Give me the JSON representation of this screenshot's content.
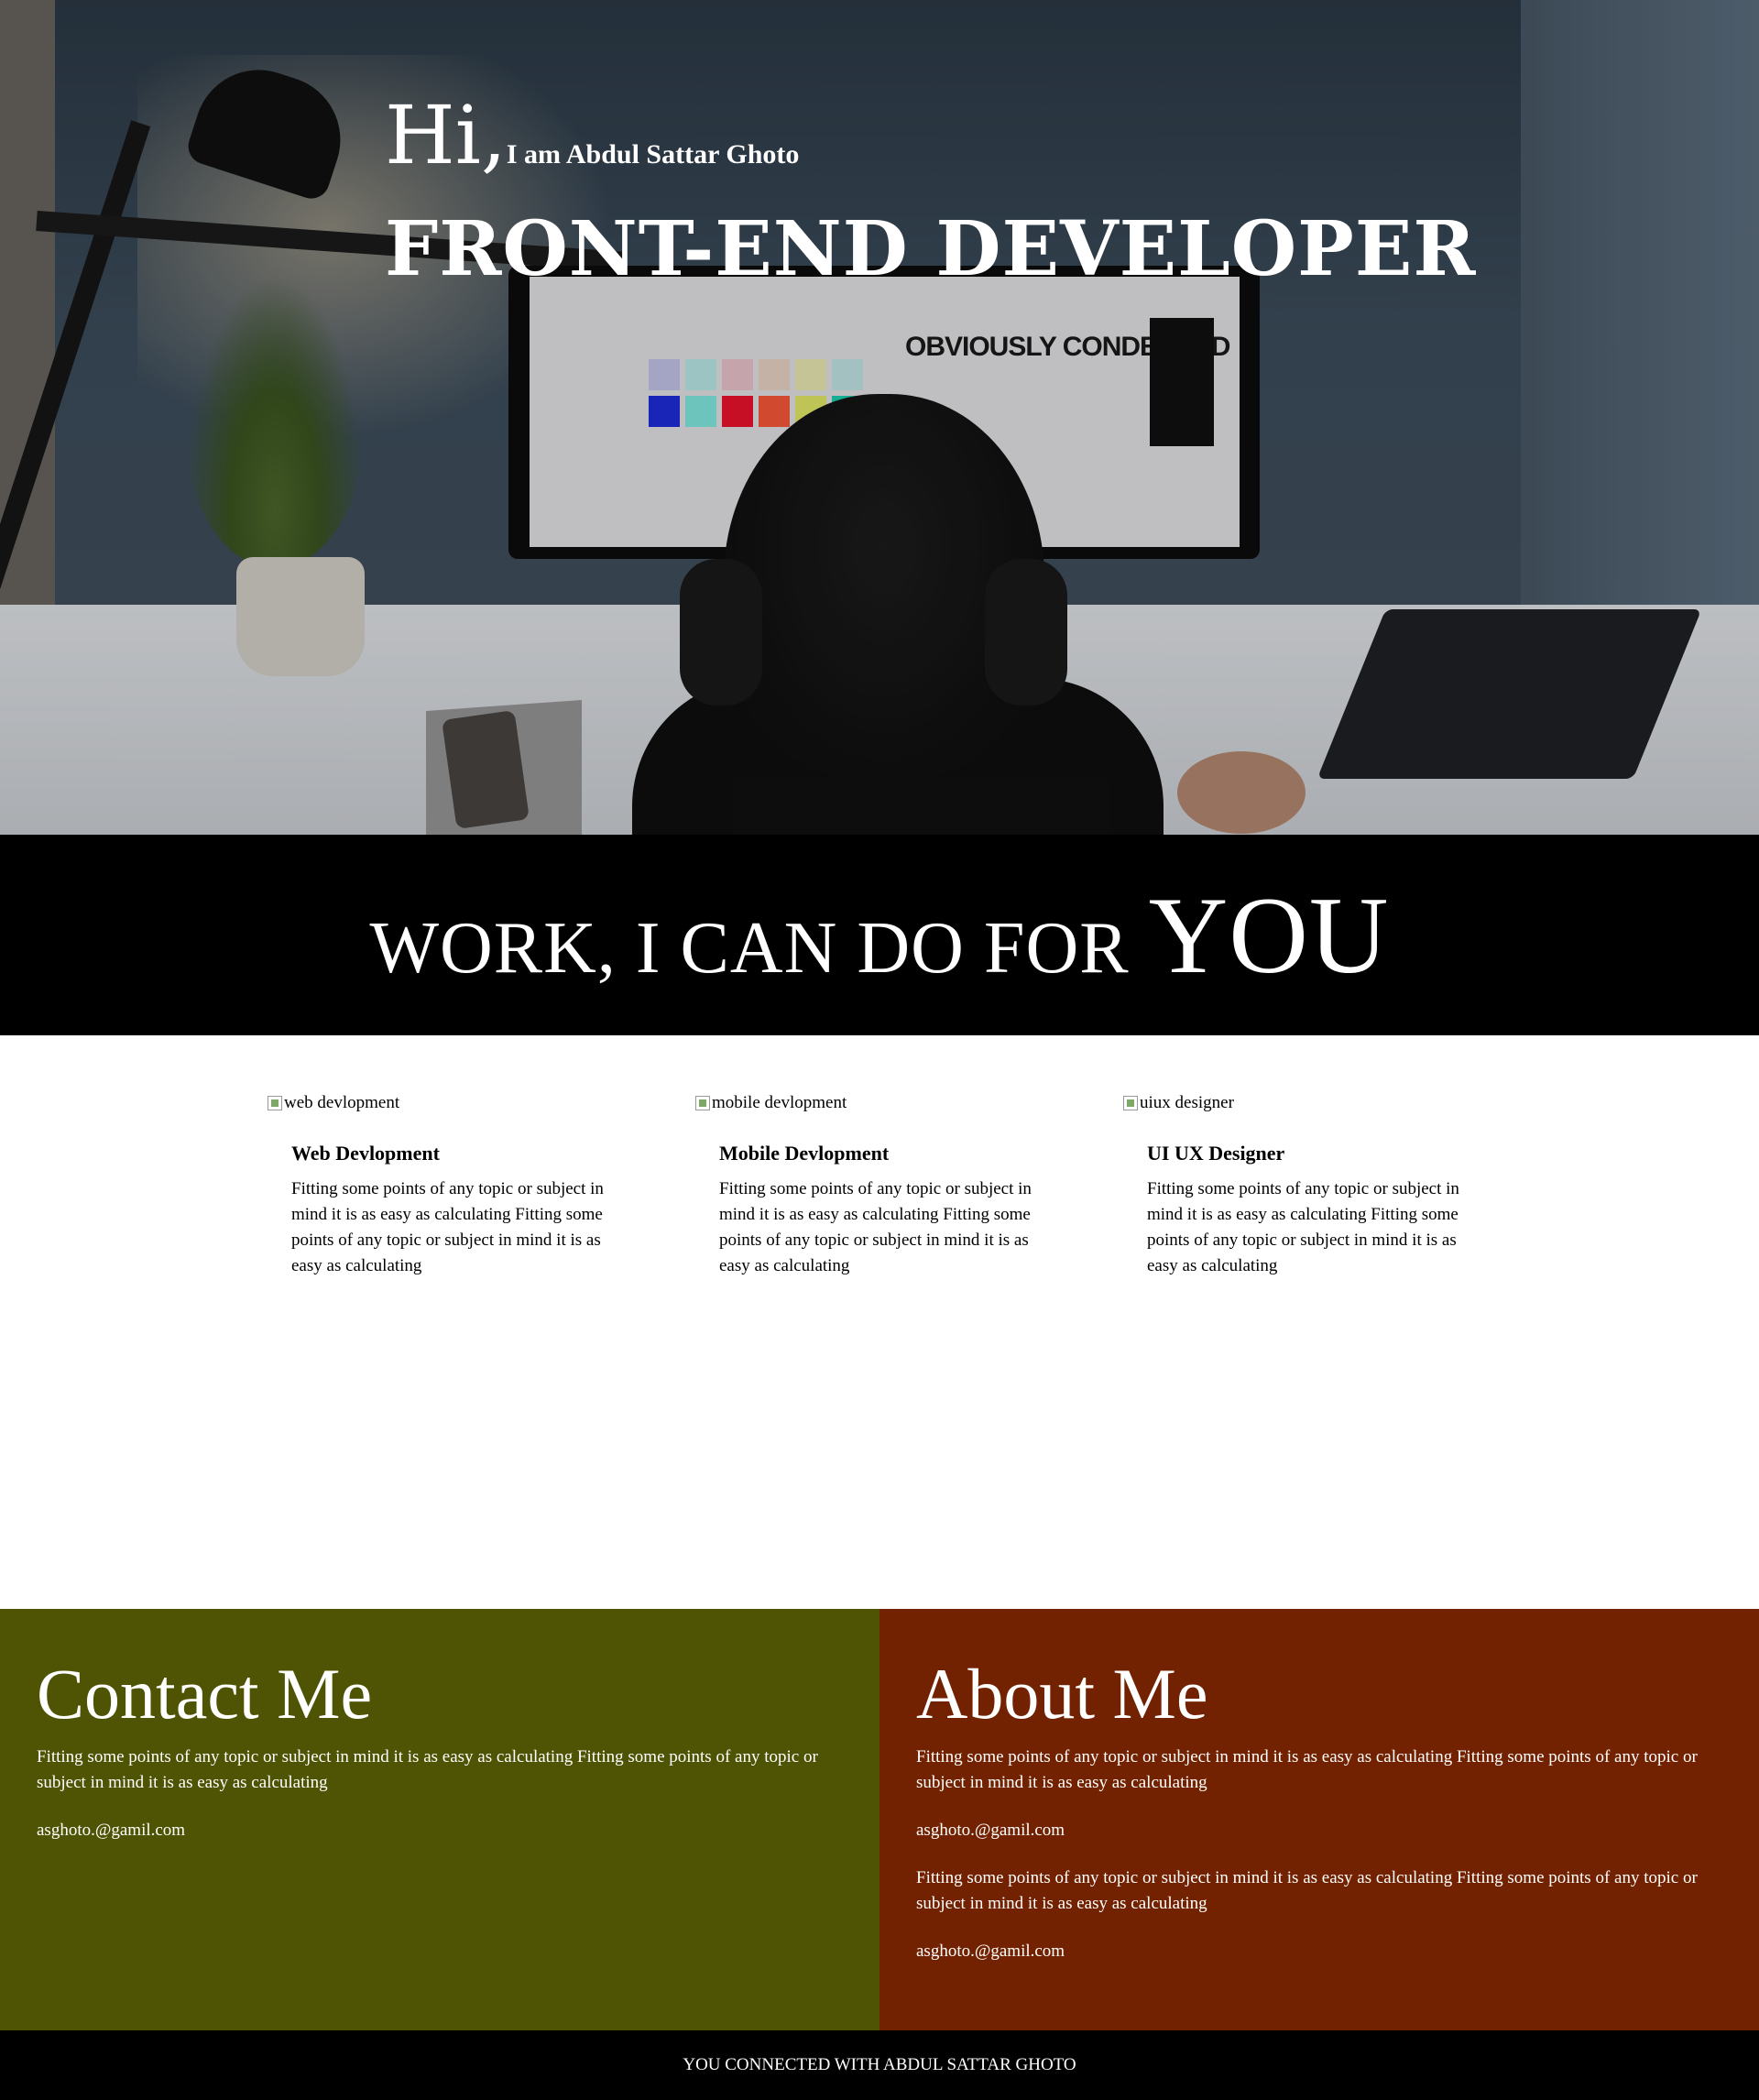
{
  "hero": {
    "greeting": "Hi,",
    "name": "I am Abdul Sattar Ghoto",
    "title": "FRONT-END DEVELOPER",
    "screen_text": "OBVIOUSLY CONDENSED"
  },
  "work": {
    "heading": "WORK, I CAN DO FOR",
    "heading_emphasis": "YOU"
  },
  "services": [
    {
      "image_alt": "web devlopment",
      "title": "Web Devlopment",
      "text": "Fitting some points of any topic or subject in mind it is as easy as calculating Fitting some points of any topic or subject in mind it is as easy as calculating"
    },
    {
      "image_alt": "mobile devlopment",
      "title": "Mobile Devlopment",
      "text": "Fitting some points of any topic or subject in mind it is as easy as calculating Fitting some points of any topic or subject in mind it is as easy as calculating"
    },
    {
      "image_alt": "uiux designer",
      "title": "UI UX Designer",
      "text": "Fitting some points of any topic or subject in mind it is as easy as calculating Fitting some points of any topic or subject in mind it is as easy as calculating"
    }
  ],
  "contact": {
    "heading": "Contact Me",
    "text": "Fitting some points of any topic or subject in mind it is as easy as calculating Fitting some points of any topic or subject in mind it is as easy as calculating",
    "email": "asghoto.@gamil.com",
    "background": "#4e5403"
  },
  "about": {
    "heading": "About Me",
    "text_1": "Fitting some points of any topic or subject in mind it is as easy as calculating Fitting some points of any topic or subject in mind it is as easy as calculating",
    "email_1": "asghoto.@gamil.com",
    "text_2": "Fitting some points of any topic or subject in mind it is as easy as calculating Fitting some points of any topic or subject in mind it is as easy as calculating",
    "email_2": "asghoto.@gamil.com",
    "background": "#722200"
  },
  "footer": {
    "text": "YOU CONNECTED WITH ABDUL SATTAR GHOTO"
  }
}
